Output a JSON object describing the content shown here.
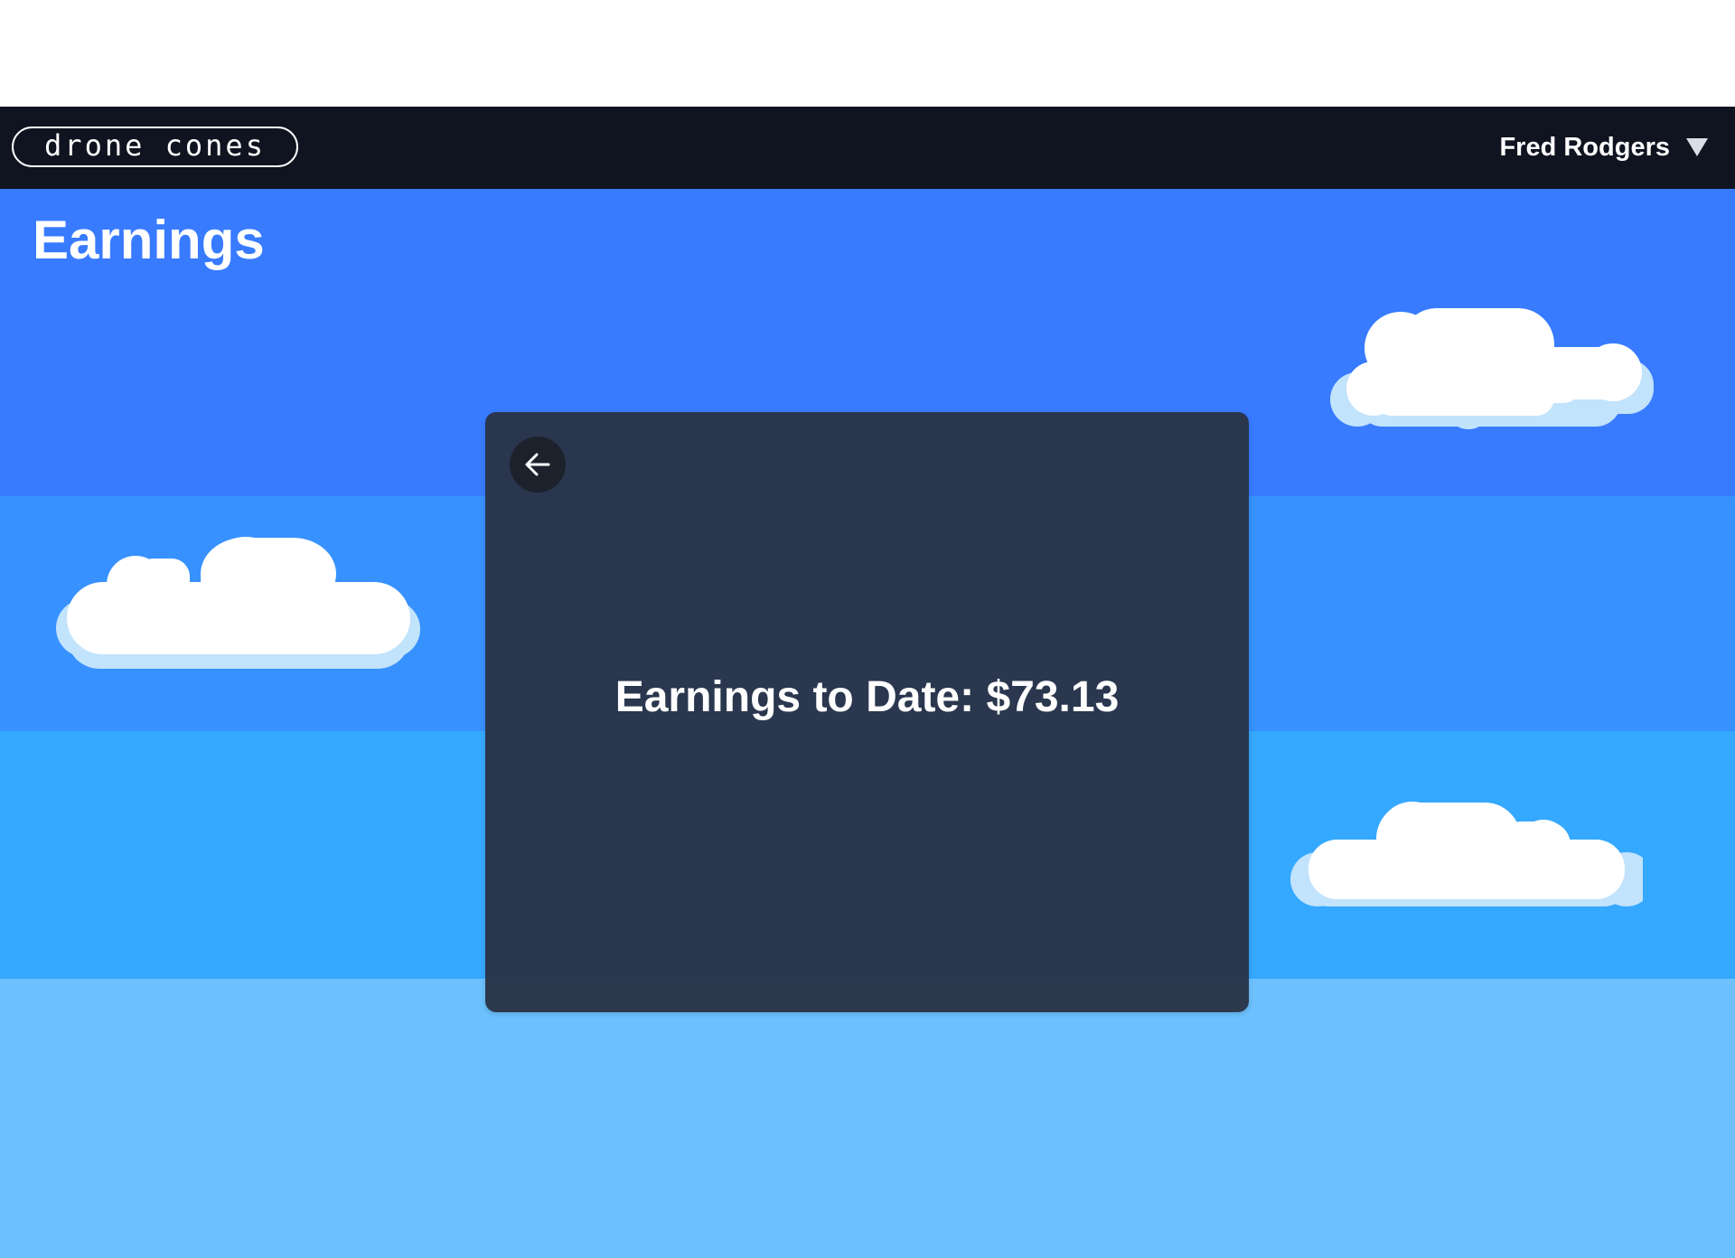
{
  "app": {
    "logo_text": "drone cones"
  },
  "header": {
    "user_name": "Fred Rodgers",
    "menu_icon": "caret-down-icon"
  },
  "page": {
    "title": "Earnings"
  },
  "earnings_card": {
    "back_icon": "arrow-left-icon",
    "label": "Earnings to Date:",
    "amount": "$73.13"
  },
  "colors": {
    "navbar": "#0f1420",
    "sky_band_1": "#387bff",
    "sky_band_2": "#3791ff",
    "sky_band_3": "#35a8ff",
    "sky_band_4": "#6bc0fd",
    "card": "#2a3448",
    "cloud_shadow": "#c2e3fc",
    "cloud": "#ffffff"
  }
}
